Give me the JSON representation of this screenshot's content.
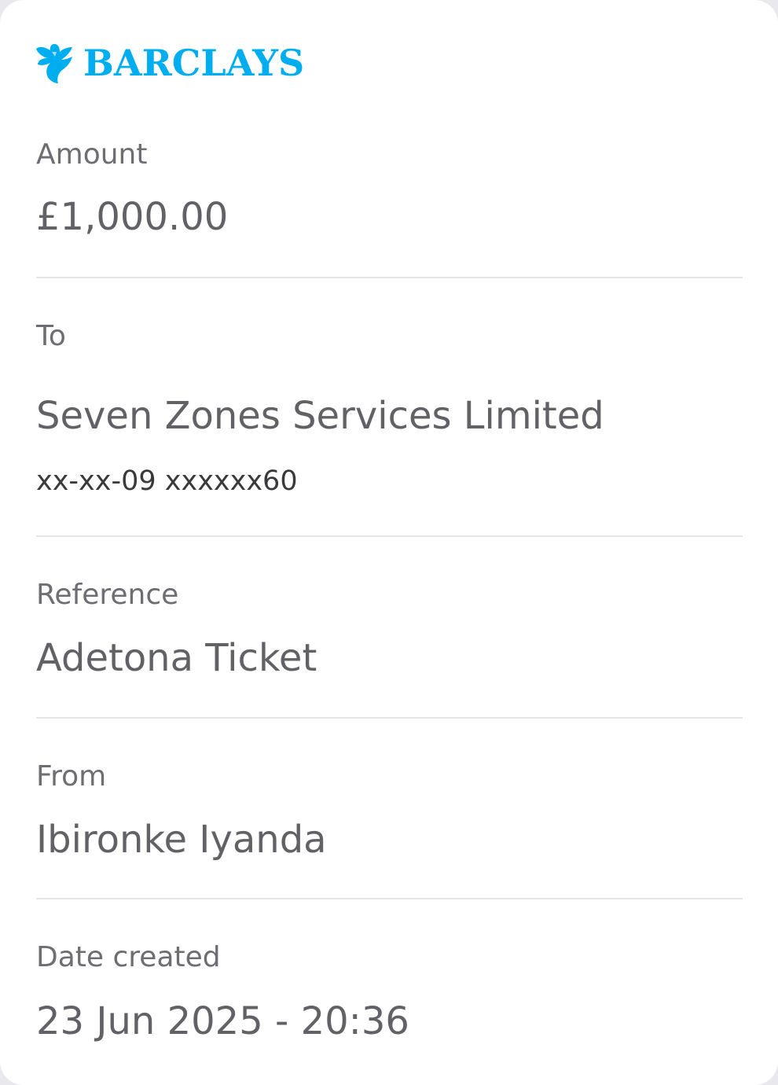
{
  "brand": {
    "name": "BARCLAYS",
    "logo_icon": "eagle-icon",
    "color": "#00aeef"
  },
  "receipt": {
    "amount": {
      "label": "Amount",
      "value": "£1,000.00"
    },
    "to": {
      "label": "To",
      "value": "Seven Zones Services Limited",
      "account": "xx-xx-09 xxxxxx60"
    },
    "reference": {
      "label": "Reference",
      "value": "Adetona Ticket"
    },
    "from": {
      "label": "From",
      "value": "Ibironke Iyanda"
    },
    "date_created": {
      "label": "Date created",
      "value": "23 Jun 2025 - 20:36"
    }
  }
}
